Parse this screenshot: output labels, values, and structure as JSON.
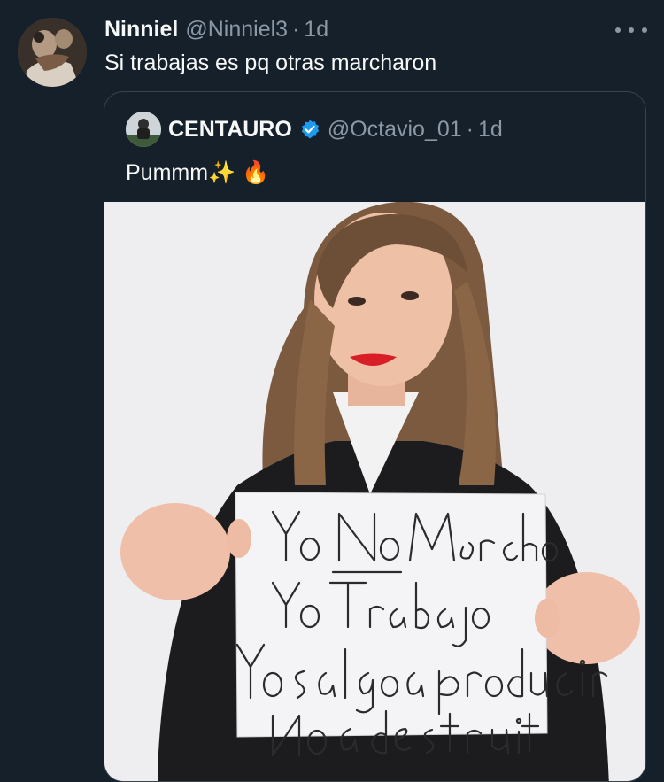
{
  "tweet": {
    "display_name": "Ninniel",
    "handle": "@Ninniel3",
    "separator": "·",
    "time": "1d",
    "text": "Si trabajas es pq otras marcharon"
  },
  "quote": {
    "display_name": "CENTAURO",
    "handle": "@Octavio_01",
    "separator": "·",
    "time": "1d",
    "text": "Pummm✨ 🔥"
  },
  "photo": {
    "sign_lines": [
      "Yo No Marcho",
      "Yo Trabajo",
      "Yo salgo a producir",
      "No a destruir"
    ]
  },
  "colors": {
    "background": "#15202b",
    "text": "#f7f9f9",
    "muted": "#8b98a5",
    "border": "#38444d",
    "verified": "#1d9bf0"
  },
  "icons": {
    "more": "more-icon",
    "verified": "verified-badge-icon"
  }
}
